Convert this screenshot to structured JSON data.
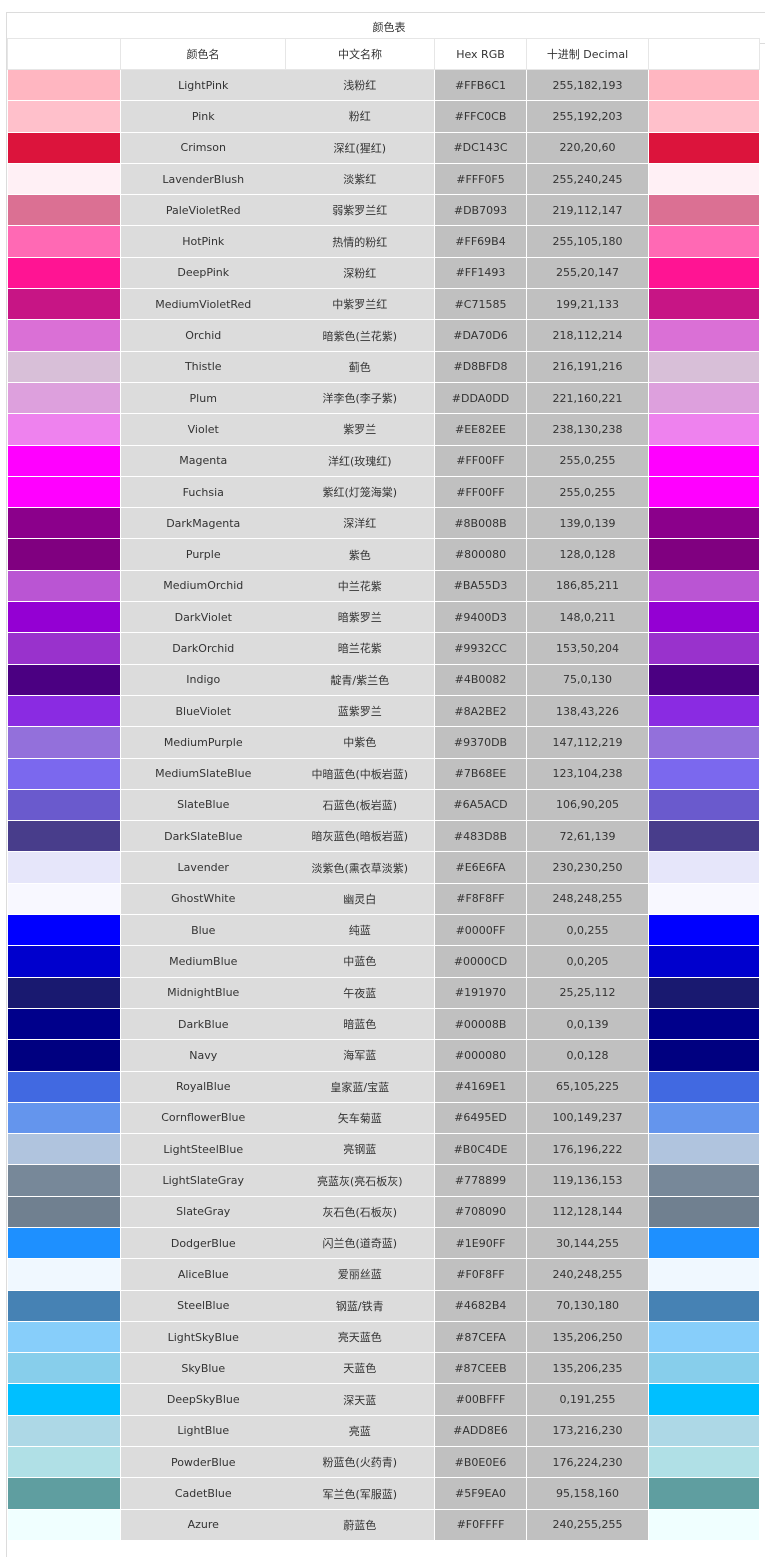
{
  "title": "颜色表",
  "columns": {
    "swatch_left": "",
    "name": "颜色名",
    "cn": "中文名称",
    "hex": "Hex RGB",
    "dec": "十进制 Decimal",
    "swatch_right": ""
  },
  "rows": [
    {
      "name": "LightPink",
      "cn": "浅粉红",
      "hex": "#FFB6C1",
      "dec": "255,182,193"
    },
    {
      "name": "Pink",
      "cn": "粉红",
      "hex": "#FFC0CB",
      "dec": "255,192,203"
    },
    {
      "name": "Crimson",
      "cn": "深红(猩红)",
      "hex": "#DC143C",
      "dec": "220,20,60"
    },
    {
      "name": "LavenderBlush",
      "cn": "淡紫红",
      "hex": "#FFF0F5",
      "dec": "255,240,245"
    },
    {
      "name": "PaleVioletRed",
      "cn": "弱紫罗兰红",
      "hex": "#DB7093",
      "dec": "219,112,147"
    },
    {
      "name": "HotPink",
      "cn": "热情的粉红",
      "hex": "#FF69B4",
      "dec": "255,105,180"
    },
    {
      "name": "DeepPink",
      "cn": "深粉红",
      "hex": "#FF1493",
      "dec": "255,20,147"
    },
    {
      "name": "MediumVioletRed",
      "cn": "中紫罗兰红",
      "hex": "#C71585",
      "dec": "199,21,133"
    },
    {
      "name": "Orchid",
      "cn": "暗紫色(兰花紫)",
      "hex": "#DA70D6",
      "dec": "218,112,214"
    },
    {
      "name": "Thistle",
      "cn": "蓟色",
      "hex": "#D8BFD8",
      "dec": "216,191,216"
    },
    {
      "name": "Plum",
      "cn": "洋李色(李子紫)",
      "hex": "#DDA0DD",
      "dec": "221,160,221"
    },
    {
      "name": "Violet",
      "cn": "紫罗兰",
      "hex": "#EE82EE",
      "dec": "238,130,238"
    },
    {
      "name": "Magenta",
      "cn": "洋红(玫瑰红)",
      "hex": "#FF00FF",
      "dec": "255,0,255"
    },
    {
      "name": "Fuchsia",
      "cn": "紫红(灯笼海棠)",
      "hex": "#FF00FF",
      "dec": "255,0,255"
    },
    {
      "name": "DarkMagenta",
      "cn": "深洋红",
      "hex": "#8B008B",
      "dec": "139,0,139"
    },
    {
      "name": "Purple",
      "cn": "紫色",
      "hex": "#800080",
      "dec": "128,0,128"
    },
    {
      "name": "MediumOrchid",
      "cn": "中兰花紫",
      "hex": "#BA55D3",
      "dec": "186,85,211"
    },
    {
      "name": "DarkViolet",
      "cn": "暗紫罗兰",
      "hex": "#9400D3",
      "dec": "148,0,211"
    },
    {
      "name": "DarkOrchid",
      "cn": "暗兰花紫",
      "hex": "#9932CC",
      "dec": "153,50,204"
    },
    {
      "name": "Indigo",
      "cn": "靛青/紫兰色",
      "hex": "#4B0082",
      "dec": "75,0,130"
    },
    {
      "name": "BlueViolet",
      "cn": "蓝紫罗兰",
      "hex": "#8A2BE2",
      "dec": "138,43,226"
    },
    {
      "name": "MediumPurple",
      "cn": "中紫色",
      "hex": "#9370DB",
      "dec": "147,112,219"
    },
    {
      "name": "MediumSlateBlue",
      "cn": "中暗蓝色(中板岩蓝)",
      "hex": "#7B68EE",
      "dec": "123,104,238"
    },
    {
      "name": "SlateBlue",
      "cn": "石蓝色(板岩蓝)",
      "hex": "#6A5ACD",
      "dec": "106,90,205"
    },
    {
      "name": "DarkSlateBlue",
      "cn": "暗灰蓝色(暗板岩蓝)",
      "hex": "#483D8B",
      "dec": "72,61,139"
    },
    {
      "name": "Lavender",
      "cn": "淡紫色(熏衣草淡紫)",
      "hex": "#E6E6FA",
      "dec": "230,230,250"
    },
    {
      "name": "GhostWhite",
      "cn": "幽灵白",
      "hex": "#F8F8FF",
      "dec": "248,248,255"
    },
    {
      "name": "Blue",
      "cn": "纯蓝",
      "hex": "#0000FF",
      "dec": "0,0,255"
    },
    {
      "name": "MediumBlue",
      "cn": "中蓝色",
      "hex": "#0000CD",
      "dec": "0,0,205"
    },
    {
      "name": "MidnightBlue",
      "cn": "午夜蓝",
      "hex": "#191970",
      "dec": "25,25,112"
    },
    {
      "name": "DarkBlue",
      "cn": "暗蓝色",
      "hex": "#00008B",
      "dec": "0,0,139"
    },
    {
      "name": "Navy",
      "cn": "海军蓝",
      "hex": "#000080",
      "dec": "0,0,128"
    },
    {
      "name": "RoyalBlue",
      "cn": "皇家蓝/宝蓝",
      "hex": "#4169E1",
      "dec": "65,105,225"
    },
    {
      "name": "CornflowerBlue",
      "cn": "矢车菊蓝",
      "hex": "#6495ED",
      "dec": "100,149,237"
    },
    {
      "name": "LightSteelBlue",
      "cn": "亮钢蓝",
      "hex": "#B0C4DE",
      "dec": "176,196,222"
    },
    {
      "name": "LightSlateGray",
      "cn": "亮蓝灰(亮石板灰)",
      "hex": "#778899",
      "dec": "119,136,153"
    },
    {
      "name": "SlateGray",
      "cn": "灰石色(石板灰)",
      "hex": "#708090",
      "dec": "112,128,144"
    },
    {
      "name": "DodgerBlue",
      "cn": "闪兰色(道奇蓝)",
      "hex": "#1E90FF",
      "dec": "30,144,255"
    },
    {
      "name": "AliceBlue",
      "cn": "爱丽丝蓝",
      "hex": "#F0F8FF",
      "dec": "240,248,255"
    },
    {
      "name": "SteelBlue",
      "cn": "钢蓝/铁青",
      "hex": "#4682B4",
      "dec": "70,130,180"
    },
    {
      "name": "LightSkyBlue",
      "cn": "亮天蓝色",
      "hex": "#87CEFA",
      "dec": "135,206,250"
    },
    {
      "name": "SkyBlue",
      "cn": "天蓝色",
      "hex": "#87CEEB",
      "dec": "135,206,235"
    },
    {
      "name": "DeepSkyBlue",
      "cn": "深天蓝",
      "hex": "#00BFFF",
      "dec": "0,191,255"
    },
    {
      "name": "LightBlue",
      "cn": "亮蓝",
      "hex": "#ADD8E6",
      "dec": "173,216,230"
    },
    {
      "name": "PowderBlue",
      "cn": "粉蓝色(火药青)",
      "hex": "#B0E0E6",
      "dec": "176,224,230"
    },
    {
      "name": "CadetBlue",
      "cn": "军兰色(军服蓝)",
      "hex": "#5F9EA0",
      "dec": "95,158,160"
    },
    {
      "name": "Azure",
      "cn": "蔚蓝色",
      "hex": "#F0FFFF",
      "dec": "240,255,255"
    }
  ]
}
